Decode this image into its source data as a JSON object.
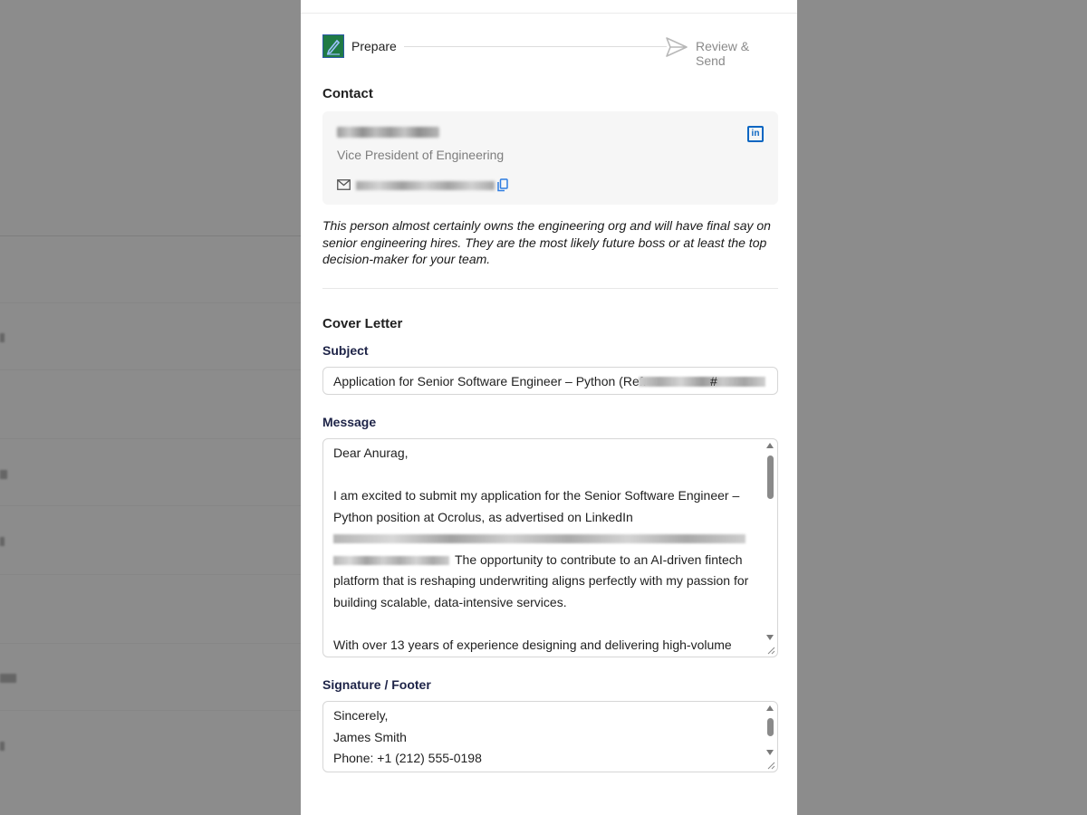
{
  "stepper": {
    "prepare_label": "Prepare",
    "review_label": "Review & Send"
  },
  "contact": {
    "section_title": "Contact",
    "title": "Vice President of Engineering",
    "note": "This person almost certainly owns the engineering org and will have final say on senior engineering hires. They are the most likely future boss or at least the top decision-maker for your team."
  },
  "cover_letter": {
    "section_title": "Cover Letter",
    "subject_label": "Subject",
    "subject_value": "Application for Senior Software Engineer – Python (Ref:",
    "subject_hash": "#",
    "message_label": "Message",
    "message_lines": {
      "l1": "Dear Anurag,",
      "l3": "I am excited to submit my application for the Senior Software Engineer –",
      "l4": "Python position at Ocrolus, as advertised on LinkedIn",
      "l6": "The opportunity to contribute to an AI-driven fintech",
      "l7": "platform that is reshaping underwriting aligns perfectly with my passion for",
      "l8": "building scalable, data-intensive services.",
      "l10": "With over 13 years of experience designing and delivering high-volume"
    },
    "signature_label": "Signature / Footer",
    "signature_lines": {
      "l1": "Sincerely,",
      "l2": "James Smith",
      "l3": "Phone: +1 (212) 555-0198"
    }
  },
  "colors": {
    "accent_blue": "#0a66c2",
    "prepare_icon_green": "#1f7a45",
    "label_navy": "#1d2347",
    "overlay": "#8c8c8c"
  },
  "icons": {
    "prepare": "pencil-icon",
    "review": "send-icon",
    "linkedin": "linkedin-icon",
    "mail": "mail-icon",
    "copy": "copy-icon"
  }
}
